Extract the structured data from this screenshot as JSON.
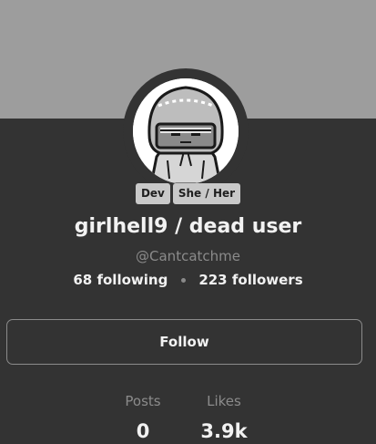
{
  "profile": {
    "display_name": "girlhell9 / dead user",
    "handle": "@Cantcatchme",
    "avatar": "hooded-character-avatar",
    "badges": [
      "Dev",
      "She / Her"
    ],
    "following_count": "68",
    "following_label": "following",
    "followers_count": "223",
    "followers_label": "followers"
  },
  "actions": {
    "follow_label": "Follow"
  },
  "stats": {
    "posts_label": "Posts",
    "posts_value": "0",
    "likes_label": "Likes",
    "likes_value": "3.9k"
  },
  "colors": {
    "banner": "#9d9d9d",
    "background": "#333333",
    "text": "#f2f2f2",
    "muted": "#8b8b8b",
    "badge": "#c9c9c9"
  }
}
